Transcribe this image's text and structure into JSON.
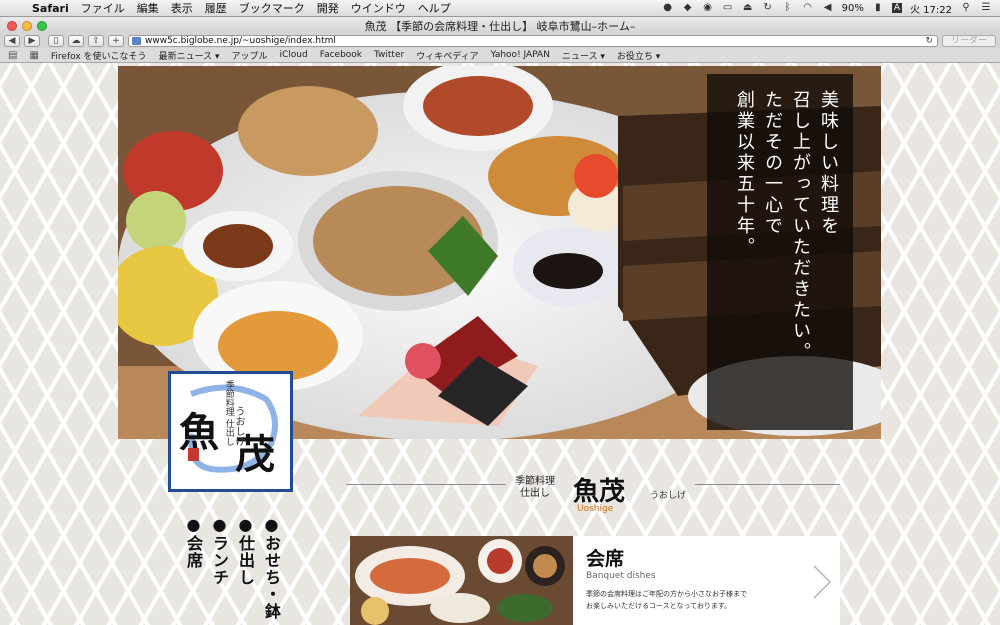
{
  "menubar": {
    "app": "Safari",
    "items": [
      "ファイル",
      "編集",
      "表示",
      "履歴",
      "ブックマーク",
      "開発",
      "ウインドウ",
      "ヘルプ"
    ],
    "battery": "90%",
    "input_indicator": "A",
    "clock": "火 17:22"
  },
  "window": {
    "title": "魚茂 【季節の会席料理・仕出し】 岐阜市鷺山–ホーム–"
  },
  "toolbar": {
    "url": "www5c.biglobe.ne.jp/~uoshige/index.html",
    "reader_label": "リーダー"
  },
  "bookmarks": {
    "items": [
      "Firefox を使いこなそう",
      "最新ニュース ▾",
      "アップル",
      "iCloud",
      "Facebook",
      "Twitter",
      "ウィキペディア",
      "Yahoo! JAPAN",
      "ニュース ▾",
      "お役立ち ▾"
    ]
  },
  "hero": {
    "tagline_col1": "美味しい料理を",
    "tagline_col2": "召し上がっていただきたい。",
    "tagline_col3": "ただその一心で",
    "tagline_col4": "創業以来五十年。"
  },
  "logo": {
    "char1": "魚",
    "char2": "茂",
    "sub": "季節料理 仕出し",
    "reading": "うおしげ"
  },
  "nav": {
    "items": [
      "●おせち・鉢",
      "●仕出し",
      "●ランチ",
      "●会席"
    ]
  },
  "heading": {
    "sub_line1": "季節料理",
    "sub_line2": "仕出し",
    "main": "魚茂",
    "reading": "うおしげ",
    "english": "Uoshige"
  },
  "card": {
    "title": "会席",
    "english": "Banquet dishes",
    "desc_line1": "季節の会席料理はご年配の方から小さなお子様まで",
    "desc_line2": "お楽しみいただけるコースとなっております。"
  }
}
